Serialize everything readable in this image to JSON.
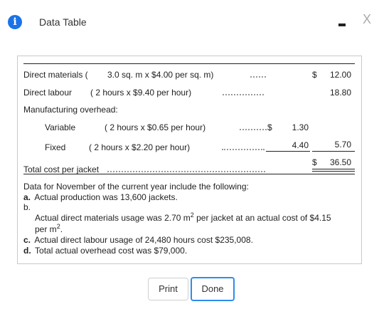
{
  "window": {
    "title": "Data Table",
    "info_glyph": "i",
    "close_glyph": "X"
  },
  "table": {
    "dm_label": "Direct materials (",
    "dm_detail": "3.0  sq. m x    $4.00  per sq. m)",
    "dm_dollar": "$",
    "dm_total": "12.00",
    "dl_label": "Direct labour",
    "dl_detail": "( 2  hours x    $9.40  per hour)",
    "dl_total": "18.80",
    "moh_label": "Manufacturing overhead:",
    "var_label": "Variable",
    "var_detail": "( 2  hours x    $0.65  per hour)",
    "var_dollar": "$",
    "var_amount": "1.30",
    "fix_label": "Fixed",
    "fix_detail": "( 2  hours x   $2.20  per hour)",
    "fix_amount": "4.40",
    "moh_total": "5.70",
    "total_label": "Total cost per jacket",
    "total_dollar": "$",
    "total_value": "36.50"
  },
  "notes": {
    "intro": "Data for November of the current year include the following:",
    "a_letter": "a.",
    "a_text": "Actual production was 13,600 jackets.",
    "b_letter": "b.",
    "b_text_1": "Actual direct materials usage was 2.70 m",
    "b_sup_1": "2",
    "b_text_2": " per jacket at an actual cost of $4.15",
    "b_text_3": "per m",
    "b_sup_2": "2",
    "b_text_4": ".",
    "c_letter": "c.",
    "c_text": "Actual direct labour usage of 24,480 hours cost $235,008.",
    "d_letter": "d.",
    "d_text": "Total actual overhead cost was $79,000."
  },
  "buttons": {
    "print": "Print",
    "done": "Done"
  },
  "colors": {
    "info_icon": "#1a73e8",
    "done_border": "#2d8cf0"
  },
  "icons": {
    "info": "info-icon",
    "minimize": "minimize-icon",
    "close": "close-icon"
  }
}
